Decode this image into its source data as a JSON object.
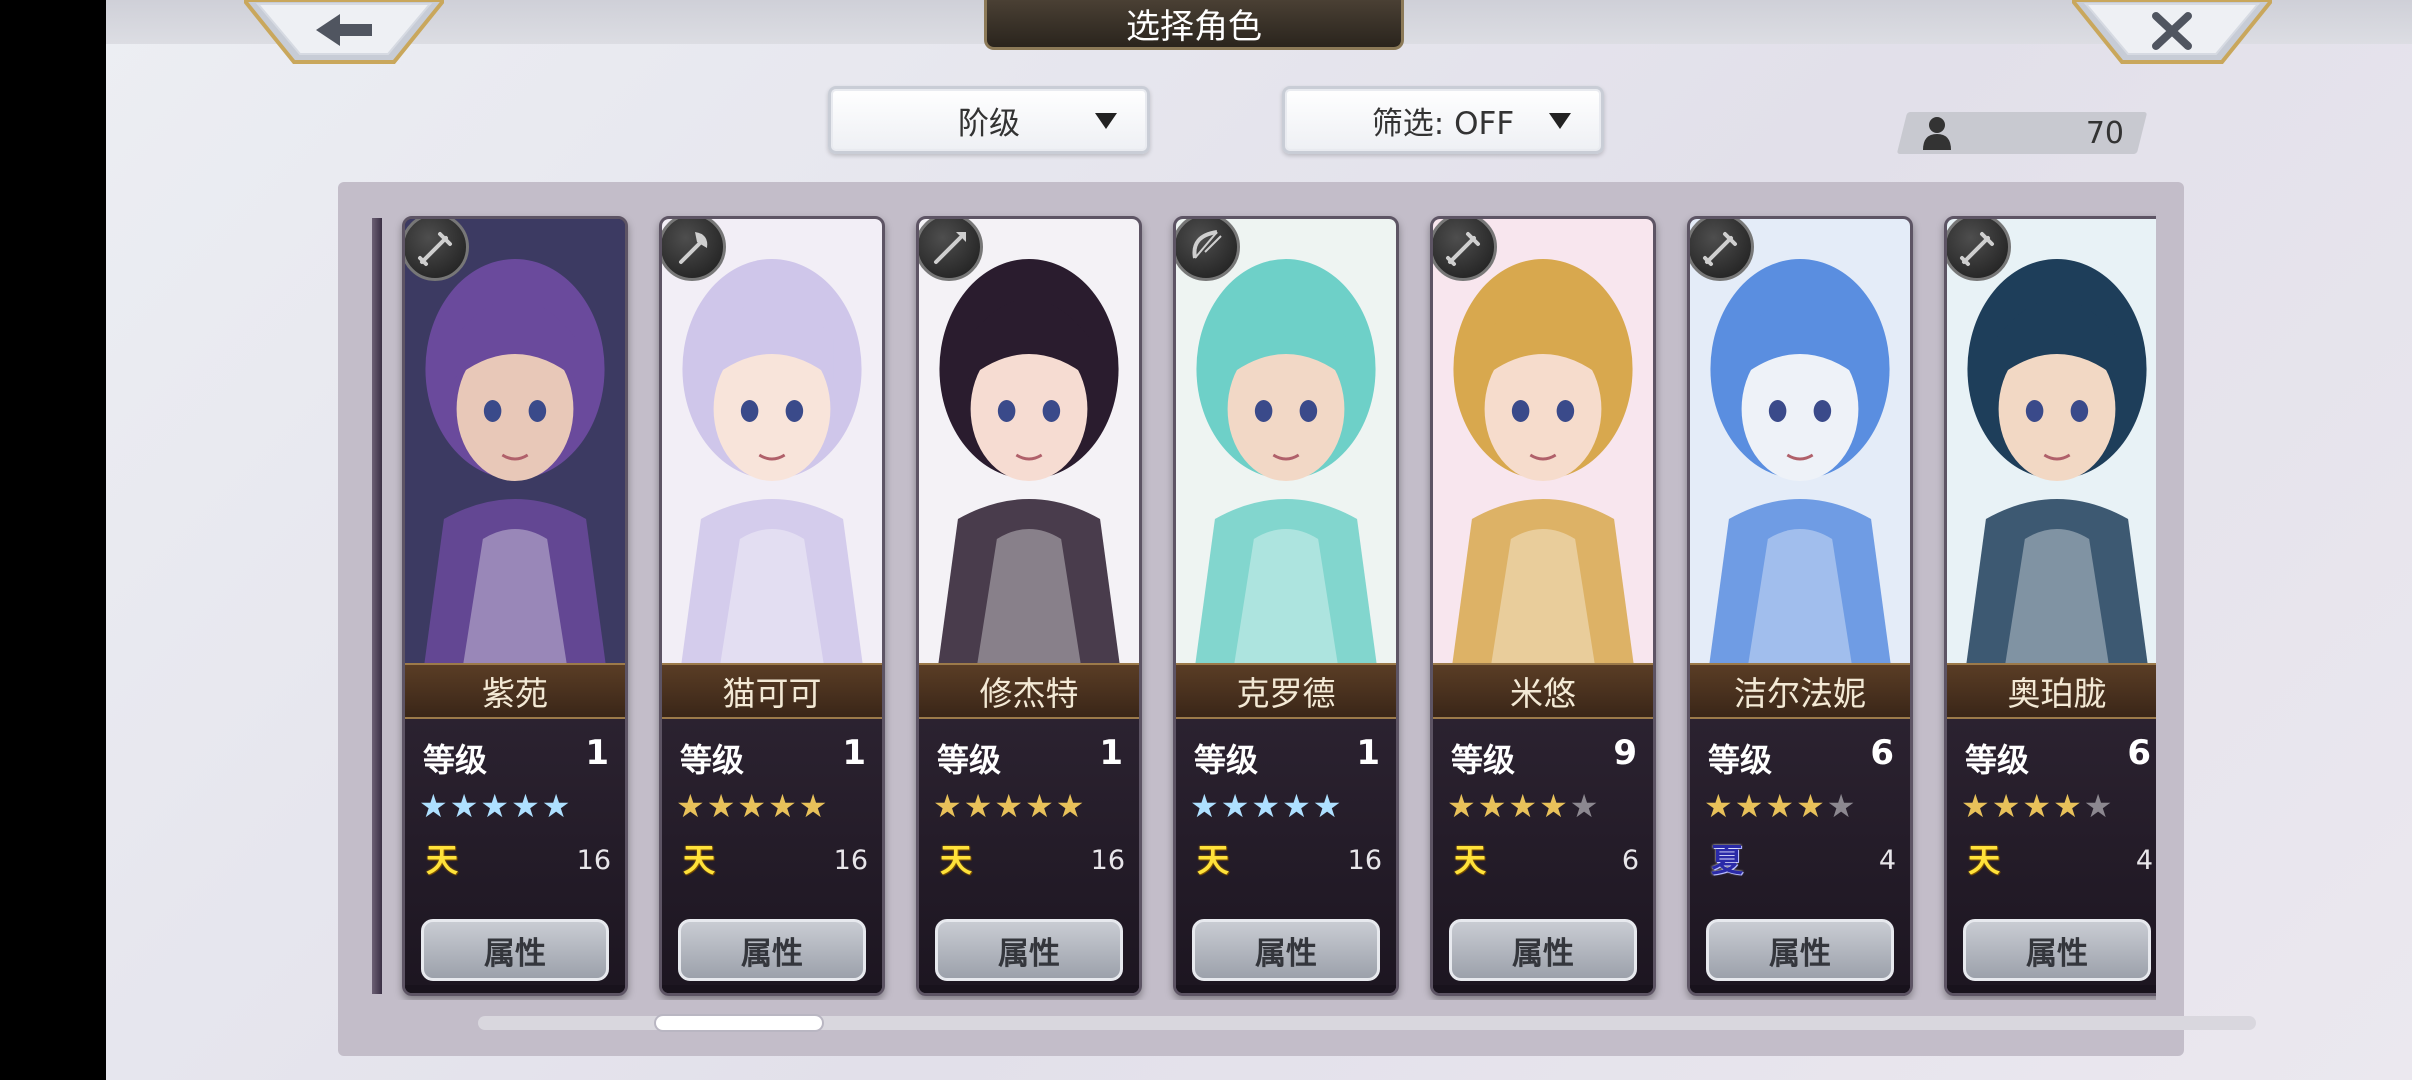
{
  "title": "选择角色",
  "nav": {
    "back_icon": "arrow-left-icon",
    "close_icon": "close-x-icon"
  },
  "filters": {
    "rank_label": "阶级",
    "filter_label": "筛选: OFF"
  },
  "count": {
    "icon": "person-icon",
    "value": "70"
  },
  "level_label": "等级",
  "attr_button_label": "属性",
  "characters": [
    {
      "name": "紫苑",
      "level": "1",
      "stars": 5,
      "star_color": "blue",
      "element": "天",
      "element_kind": "heaven",
      "element_count": "16",
      "weapon_icon": "sword-icon",
      "portrait": {
        "bg": "#3c3a62",
        "hair": "#6a4a9c",
        "skin": "#e8c8b8"
      }
    },
    {
      "name": "猫可可",
      "level": "1",
      "stars": 5,
      "star_color": "gold",
      "element": "天",
      "element_kind": "heaven",
      "element_count": "16",
      "weapon_icon": "axe-icon",
      "portrait": {
        "bg": "#f2eef6",
        "hair": "#cfc6ea",
        "skin": "#f8e4da"
      }
    },
    {
      "name": "修杰特",
      "level": "1",
      "stars": 5,
      "star_color": "gold",
      "element": "天",
      "element_kind": "heaven",
      "element_count": "16",
      "weapon_icon": "spear-icon",
      "portrait": {
        "bg": "#f4f2f6",
        "hair": "#2a1c2e",
        "skin": "#f6dcd2"
      }
    },
    {
      "name": "克罗德",
      "level": "1",
      "stars": 5,
      "star_color": "blue",
      "element": "天",
      "element_kind": "heaven",
      "element_count": "16",
      "weapon_icon": "bow-icon",
      "portrait": {
        "bg": "#eef4f2",
        "hair": "#6ed0c8",
        "skin": "#f2d8c6"
      }
    },
    {
      "name": "米悠",
      "level": "9",
      "stars": 4,
      "star_color": "gold",
      "element": "天",
      "element_kind": "heaven",
      "element_count": "6",
      "weapon_icon": "sword-icon",
      "portrait": {
        "bg": "#f8e6ee",
        "hair": "#d8a84e",
        "skin": "#f6dccc"
      }
    },
    {
      "name": "洁尔法妮",
      "level": "6",
      "stars": 4,
      "star_color": "gold",
      "element": "夏",
      "element_kind": "summer",
      "element_count": "4",
      "weapon_icon": "sword-icon",
      "portrait": {
        "bg": "#e4ecf8",
        "hair": "#5a8ee0",
        "skin": "#eef2f8"
      }
    },
    {
      "name": "奥珀胧",
      "level": "6",
      "stars": 4,
      "star_color": "gold",
      "element": "天",
      "element_kind": "heaven",
      "element_count": "4",
      "weapon_icon": "sword-icon",
      "portrait": {
        "bg": "#e8f2f6",
        "hair": "#1e3e5a",
        "skin": "#f2d8c4"
      }
    }
  ]
}
